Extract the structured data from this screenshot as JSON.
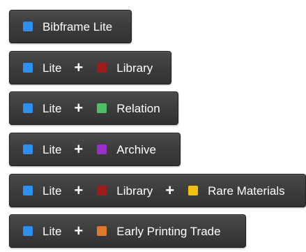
{
  "colors": {
    "lite": "#2d8ff0",
    "library": "#a01c1c",
    "relation": "#4dbf66",
    "archive": "#9b2fc9",
    "rare_materials": "#f0c010",
    "early_printing_trade": "#e0782e"
  },
  "buttons": [
    {
      "parts": [
        {
          "label": "Bibframe Lite",
          "swatch": "lite"
        }
      ]
    },
    {
      "parts": [
        {
          "label": "Lite",
          "swatch": "lite"
        },
        {
          "label": "Library",
          "swatch": "library"
        }
      ]
    },
    {
      "parts": [
        {
          "label": "Lite",
          "swatch": "lite"
        },
        {
          "label": "Relation",
          "swatch": "relation"
        }
      ]
    },
    {
      "parts": [
        {
          "label": "Lite",
          "swatch": "lite"
        },
        {
          "label": "Archive",
          "swatch": "archive"
        }
      ]
    },
    {
      "parts": [
        {
          "label": "Lite",
          "swatch": "lite"
        },
        {
          "label": "Library",
          "swatch": "library"
        },
        {
          "label": "Rare Materials",
          "swatch": "rare_materials"
        }
      ]
    },
    {
      "parts": [
        {
          "label": "Lite",
          "swatch": "lite"
        },
        {
          "label": "Early Printing Trade",
          "swatch": "early_printing_trade"
        }
      ]
    }
  ],
  "separator": "+"
}
